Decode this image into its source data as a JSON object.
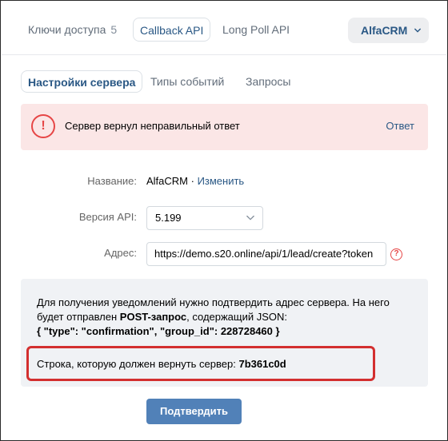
{
  "top_tabs": {
    "access_keys_label": "Ключи доступа",
    "access_keys_count": "5",
    "callback_api_label": "Callback API",
    "long_poll_label": "Long Poll API"
  },
  "app_selector": {
    "label": "AlfaCRM",
    "icon": "chevron-down-icon"
  },
  "sub_tabs": {
    "server_settings": "Настройки сервера",
    "event_types": "Типы событий",
    "requests": "Запросы"
  },
  "error": {
    "icon": "exclamation-circle-icon",
    "icon_glyph": "!",
    "message": "Сервер вернул неправильный ответ",
    "link": "Ответ",
    "color": "#e64646"
  },
  "form": {
    "name_label": "Название:",
    "name_value": "AlfaCRM · ",
    "name_change_link": "Изменить",
    "version_label": "Версия API:",
    "version_value": "5.199",
    "address_label": "Адрес:",
    "address_value": "https://demo.s20.online/api/1/lead/create?token",
    "help_icon_glyph": "?"
  },
  "info": {
    "line1": "Для получения уведомлений нужно подтвердить адрес сервера. На него будет отправлен ",
    "post_request": "POST-запрос",
    "line2": ", содержащий JSON:",
    "json": "{ \"type\": \"confirmation\", \"group_id\": 228728460 }",
    "return_label": "Строка, которую должен вернуть сервер: ",
    "return_code": "7b361c0d"
  },
  "confirm_button": "Подтвердить",
  "colors": {
    "accent": "#2a5885",
    "button": "#5181b8",
    "error_bg": "#fbe6e6",
    "highlight": "#d32f2f"
  }
}
